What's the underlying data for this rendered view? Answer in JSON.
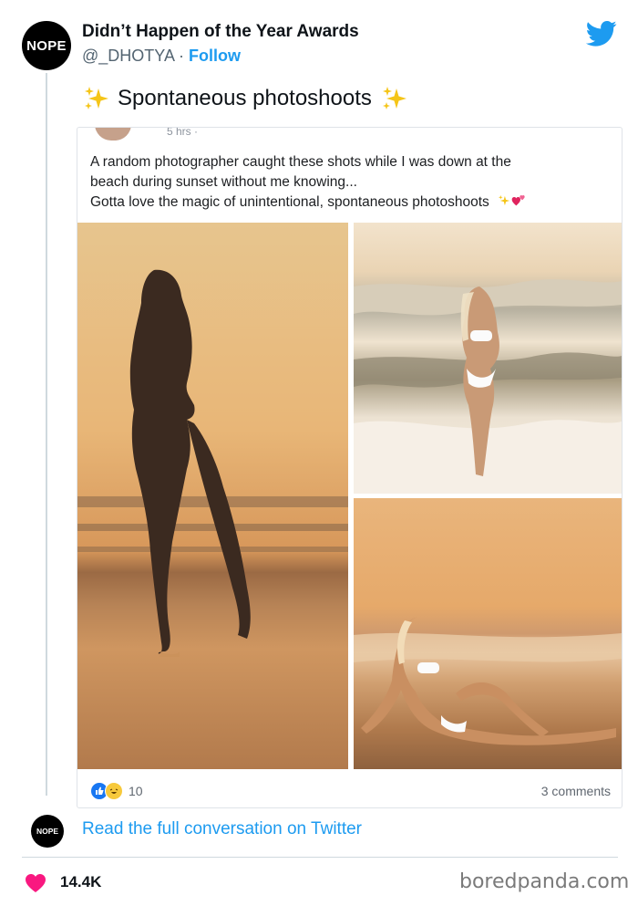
{
  "tweet": {
    "author_avatar_text": "NOPE",
    "author_name": "Didn’t Happen of the Year Awards",
    "handle": "@_DHOTYA",
    "separator": " · ",
    "follow_label": "Follow",
    "text": "Spontaneous photoshoots",
    "brand_color": "#1d9bf0"
  },
  "embedded_post": {
    "time": "5 hrs ·",
    "lines": [
      "A random photographer caught these shots while I was down at the",
      "beach during sunset without me knowing...",
      "Gotta love the magic of unintentional, spontaneous photoshoots"
    ],
    "reaction_count": "10",
    "comments": "3 comments"
  },
  "footer": {
    "avatar_text": "NOPE",
    "read_link": "Read the full conversation on Twitter",
    "likes": "14.4K",
    "watermark": "boredpanda.com"
  },
  "icons": {
    "twitter": "twitter-bird-icon",
    "sparkles": "sparkles-icon",
    "heart": "heart-icon"
  }
}
